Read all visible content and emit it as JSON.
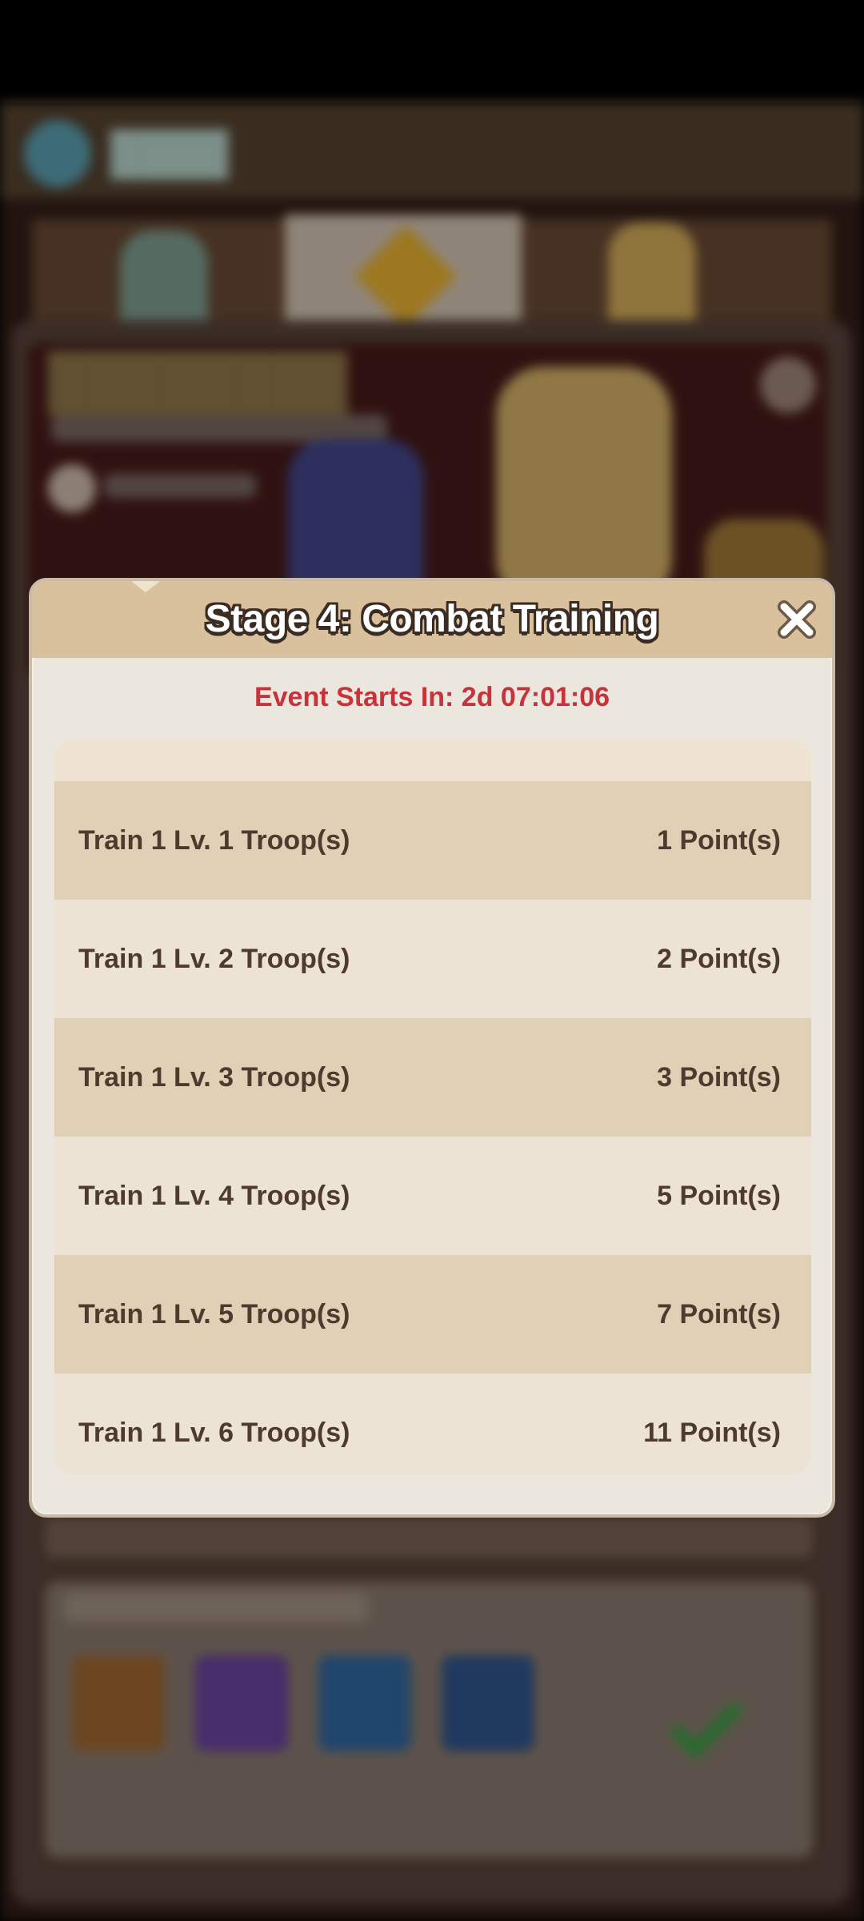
{
  "modal": {
    "title": "Stage 4: Combat Training",
    "event_timer": "Event Starts In: 2d 07:01:06",
    "close_icon": "close-icon"
  },
  "tasks": [
    {
      "task": "Train 1 Lv. 1 Troop(s)",
      "points": "1 Point(s)"
    },
    {
      "task": "Train 1 Lv. 2 Troop(s)",
      "points": "2 Point(s)"
    },
    {
      "task": "Train 1 Lv. 3 Troop(s)",
      "points": "3 Point(s)"
    },
    {
      "task": "Train 1 Lv. 4 Troop(s)",
      "points": "5 Point(s)"
    },
    {
      "task": "Train 1 Lv. 5 Troop(s)",
      "points": "7 Point(s)"
    },
    {
      "task": "Train 1 Lv. 6 Troop(s)",
      "points": "11 Point(s)"
    }
  ],
  "colors": {
    "header": "#d8c19c",
    "modal_bg": "#ebe7df",
    "timer_red": "#c8323a",
    "row_dark": "#e0d0b6",
    "row_light": "#ede3d4",
    "text": "#4e3a2e"
  }
}
